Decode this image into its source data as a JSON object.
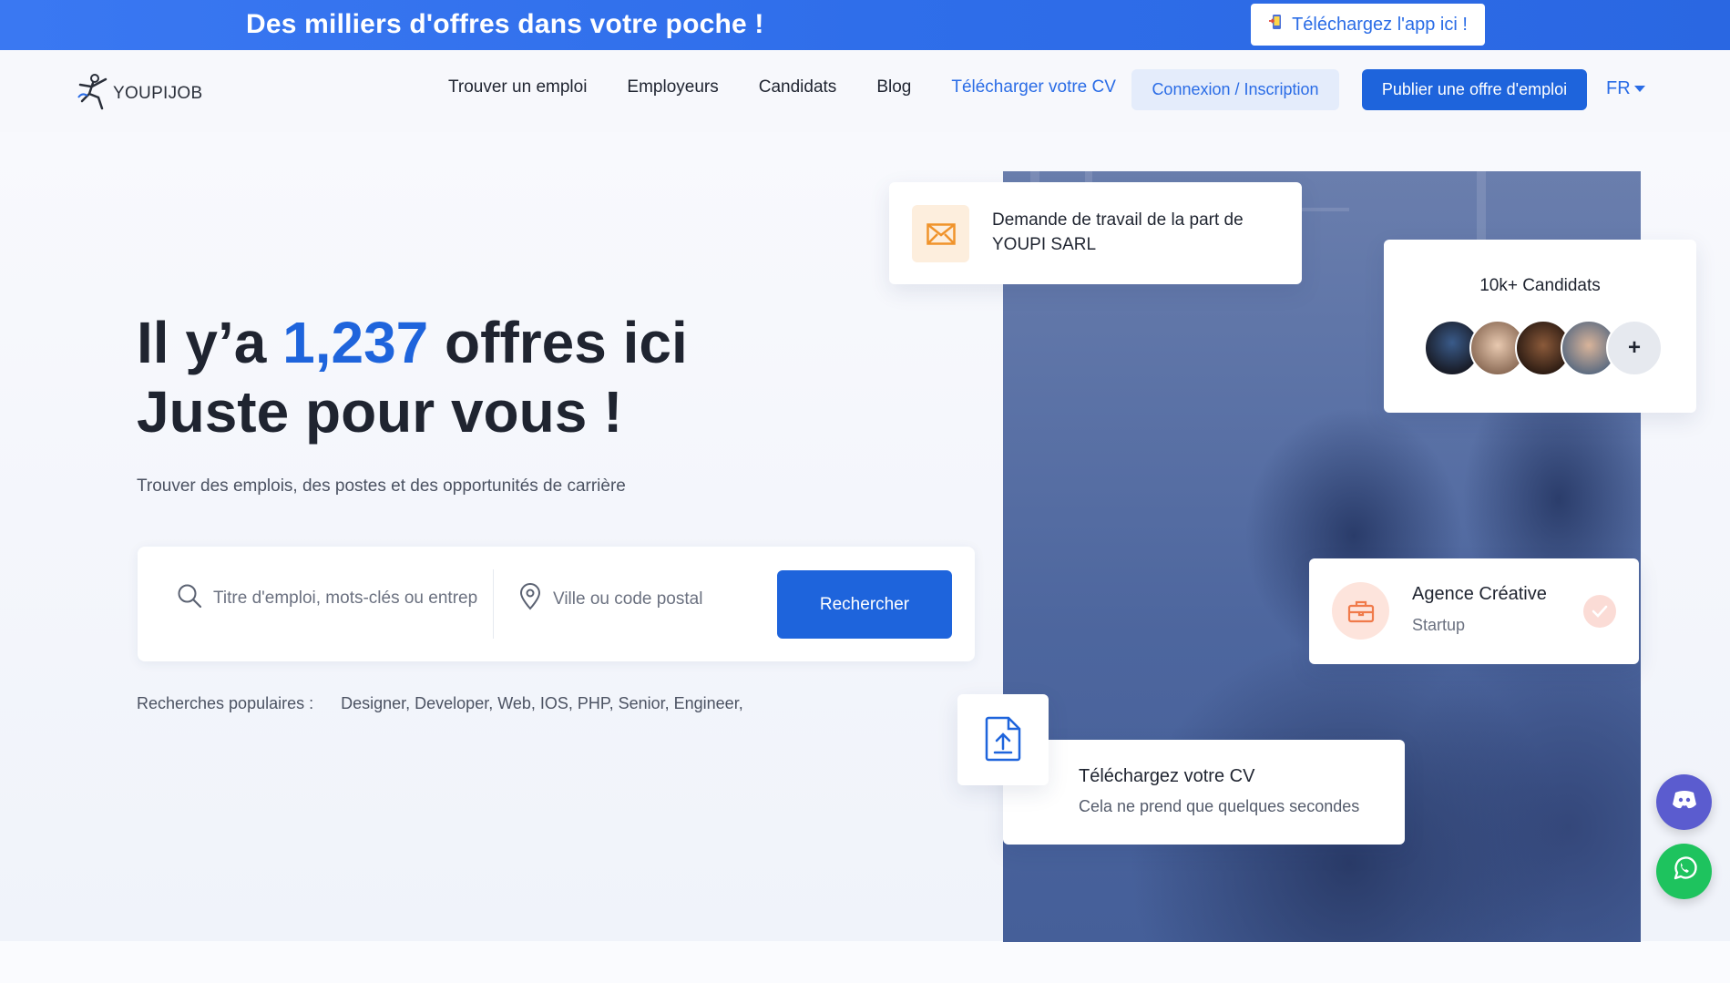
{
  "banner": {
    "title": "Des milliers d'offres dans votre poche !",
    "app_button": "Téléchargez l'app ici !",
    "app_icon": "phone-download-icon"
  },
  "header": {
    "logo_text": "YOUPIJOB",
    "nav": [
      {
        "label": "Trouver un emploi"
      },
      {
        "label": "Employeurs"
      },
      {
        "label": "Candidats"
      },
      {
        "label": "Blog"
      },
      {
        "label": "Télécharger votre CV"
      }
    ],
    "login_label": "Connexion / Inscription",
    "publish_label": "Publier une offre d'emploi",
    "language": "FR"
  },
  "hero": {
    "headline_prefix": "Il y’a ",
    "count": "1,237",
    "headline_suffix": " offres ici",
    "headline_line2": "Juste pour vous !",
    "subtitle": "Trouver des emplois, des postes et des opportunités de carrière",
    "search": {
      "keyword_placeholder": "Titre d'emploi, mots-clés ou entreprise",
      "location_placeholder": "Ville ou code postal",
      "button": "Rechercher"
    },
    "popular_label": "Recherches populaires :",
    "popular_tags": "Designer, Developer, Web, IOS, PHP, Senior, Engineer,"
  },
  "cards": {
    "demand": "Demande de travail de la part de YOUPI SARL",
    "candidates": "10k+ Candidats",
    "candidates_more": "+",
    "agency_name": "Agence Créative",
    "agency_type": "Startup",
    "upload_title": "Téléchargez votre CV",
    "upload_sub": "Cela ne prend que quelques secondes"
  },
  "colors": {
    "primary": "#1e64dc",
    "banner": "#2f6eea",
    "discord": "#5b5ccf",
    "whatsapp": "#1ec35e"
  }
}
